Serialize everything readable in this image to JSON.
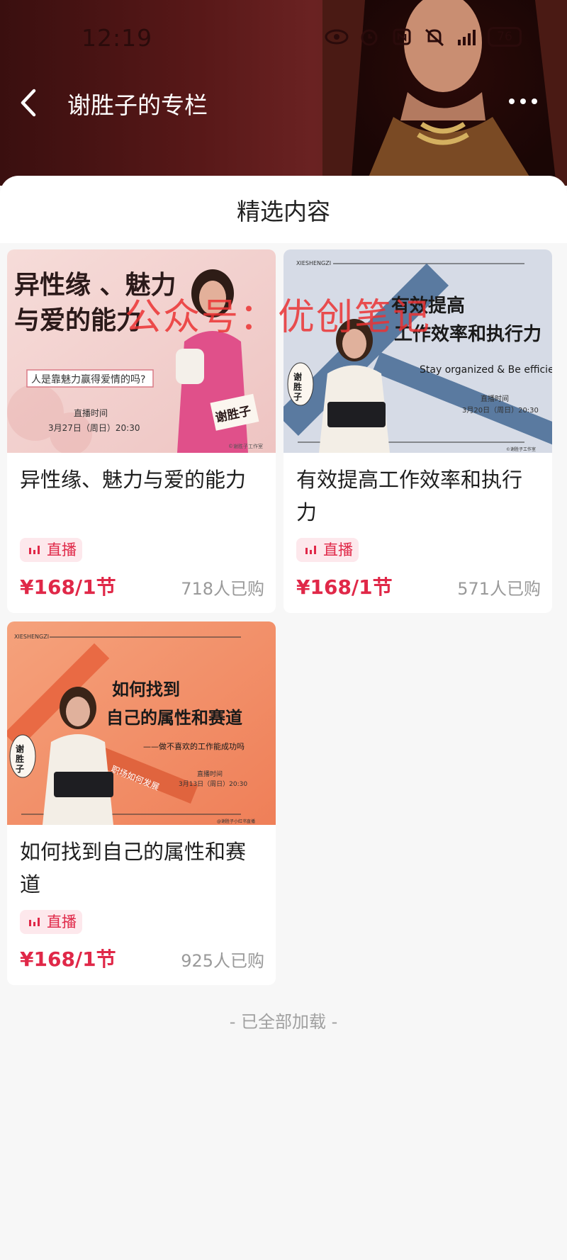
{
  "status_bar": {
    "time": "12:19",
    "battery": "76"
  },
  "nav": {
    "title": "谢胜子的专栏",
    "back_icon": "chevron-left-icon",
    "more_icon": "more-dots-icon"
  },
  "section": {
    "title": "精选内容"
  },
  "watermark": "公众号：优创笔记",
  "courses": [
    {
      "title": "异性缘、魅力与爱的能力",
      "tag": "直播",
      "price": "¥168/1节",
      "sold": "718人已购",
      "cover": {
        "headline_1": "异性缘 、魅力",
        "headline_2": "与爱的能力",
        "subtitle": "人是靠魅力赢得爱情的吗?",
        "time_label": "直播时间",
        "time": "3月27日（周日）20:30",
        "sign": "谢胜子",
        "credit": "©谢胜子工作室"
      }
    },
    {
      "title": "有效提高工作效率和执行力",
      "tag": "直播",
      "price": "¥168/1节",
      "sold": "571人已购",
      "cover": {
        "brand": "XIESHENGZI",
        "headline_1": "有效提高",
        "headline_2": "工作效率和执行力",
        "subtitle": "Stay organized & Be efficient",
        "time_label": "直播时间",
        "time": "3月20日（周日）20:30",
        "sign": "谢胜子",
        "credit": "©谢胜子工作室"
      }
    },
    {
      "title": "如何找到自己的属性和赛道",
      "tag": "直播",
      "price": "¥168/1节",
      "sold": "925人已购",
      "cover": {
        "brand": "XIESHENGZI",
        "headline_1": "如何找到",
        "headline_2": "自己的属性和赛道",
        "subtitle": "——做不喜欢的工作能成功吗",
        "time_label": "直播时间",
        "time": "3月13日（周日）20:30",
        "sign": "谢胜子",
        "ribbon": "职场如何发展",
        "credit": "@谢胜子小红书直播"
      }
    }
  ],
  "footer": "- 已全部加载 -"
}
